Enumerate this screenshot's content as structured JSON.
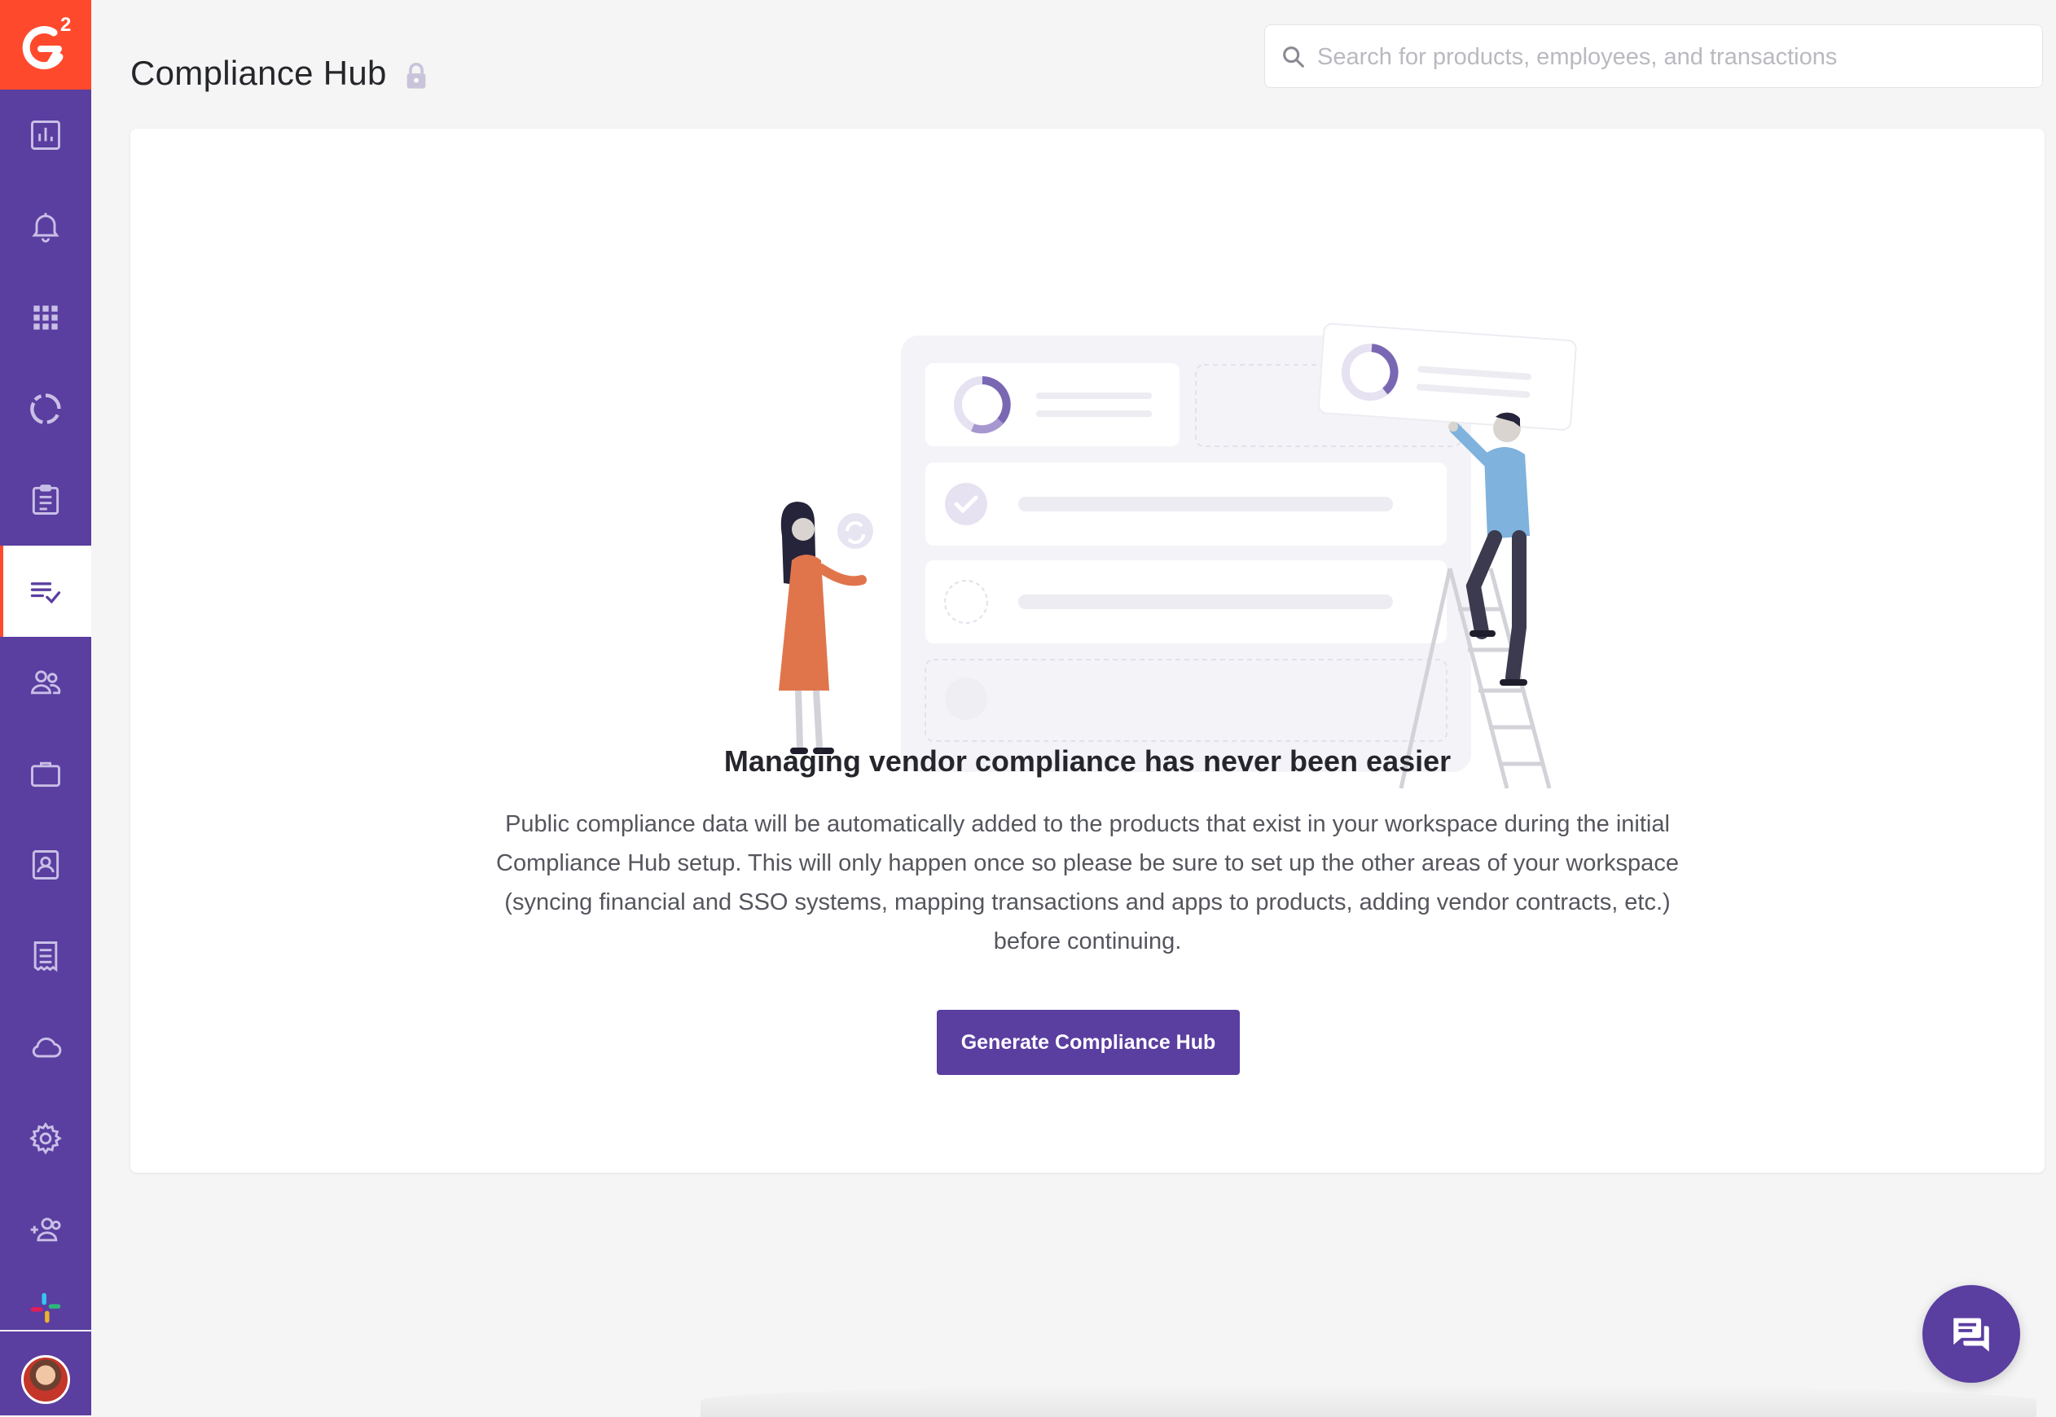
{
  "app": {
    "brand": "G2",
    "accent_color": "#5a3ea0",
    "brand_color": "#ff492c"
  },
  "sidebar": {
    "items": [
      {
        "icon": "bar-chart-icon",
        "active": false
      },
      {
        "icon": "bell-icon",
        "active": false
      },
      {
        "icon": "grid-icon",
        "active": false
      },
      {
        "icon": "donut-chart-icon",
        "active": false
      },
      {
        "icon": "clipboard-icon",
        "active": false
      },
      {
        "icon": "checklist-icon",
        "active": true
      },
      {
        "icon": "people-icon",
        "active": false
      },
      {
        "icon": "briefcase-icon",
        "active": false
      },
      {
        "icon": "contact-card-icon",
        "active": false
      },
      {
        "icon": "receipt-icon",
        "active": false
      },
      {
        "icon": "cloud-icon",
        "active": false
      },
      {
        "icon": "gear-icon",
        "active": false
      },
      {
        "icon": "add-user-icon",
        "active": false
      },
      {
        "icon": "slack-icon",
        "active": false
      }
    ]
  },
  "header": {
    "title": "Compliance Hub",
    "title_icon": "lock-icon"
  },
  "search": {
    "placeholder": "Search for products, employees, and transactions",
    "value": ""
  },
  "main": {
    "headline": "Managing vendor compliance has never been easier",
    "description": "Public compliance data will be automatically added to the products that exist in your workspace during the initial Compliance Hub setup. This will only happen once so please be sure to set up the other areas of your workspace (syncing financial and SSO systems, mapping transactions and apps to products, adding vendor contracts, etc.) before continuing.",
    "cta_label": "Generate Compliance Hub"
  },
  "chat": {
    "icon": "chat-bubbles-icon"
  }
}
